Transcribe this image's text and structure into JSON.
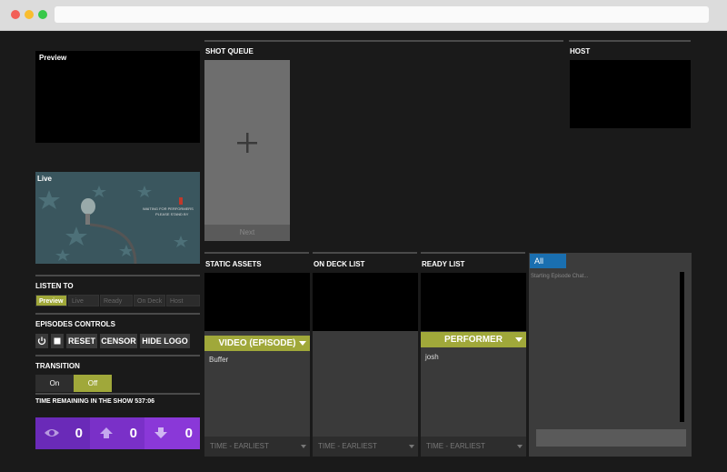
{
  "preview": {
    "label": "Preview"
  },
  "live": {
    "label": "Live",
    "poster_line1": "WAITING FOR PERFORMERS",
    "poster_line2": "PLEASE STAND BY"
  },
  "shot_queue": {
    "title": "SHOT QUEUE",
    "add_icon": "plus-icon",
    "next_label": "Next"
  },
  "host": {
    "title": "HOST"
  },
  "listen_to": {
    "title": "LISTEN TO",
    "options": [
      "Preview",
      "Live",
      "Ready",
      "On Deck",
      "Host"
    ],
    "selected": "Preview"
  },
  "episode_controls": {
    "title": "EPISODES CONTROLS",
    "power_icon": "power-icon",
    "stop_icon": "stop-icon",
    "reset_label": "RESET",
    "censor_label": "CENSOR",
    "hide_logo_label": "HIDE LOGO"
  },
  "transition": {
    "title": "TRANSITION",
    "on_label": "On",
    "off_label": "Off",
    "selected": "Off"
  },
  "time_remaining": {
    "label": "TIME REMAINING IN THE SHOW 537:06"
  },
  "counters": [
    {
      "icon": "eye-icon",
      "value": "0",
      "color": "#6a2ab8"
    },
    {
      "icon": "arrow-up-icon",
      "value": "0",
      "color": "#7a30c8"
    },
    {
      "icon": "arrow-down-icon",
      "value": "0",
      "color": "#8a38d8"
    }
  ],
  "static_assets": {
    "title": "STATIC ASSETS",
    "select_value": "VIDEO (EPISODE)",
    "items": [
      "Buffer"
    ],
    "sort_label": "TIME - EARLIEST"
  },
  "on_deck": {
    "title": "ON DECK LIST",
    "sort_label": "TIME - EARLIEST"
  },
  "ready_list": {
    "title": "READY LIST",
    "select_value": "PERFORMER",
    "items": [
      "josh"
    ],
    "sort_label": "TIME - EARLIEST"
  },
  "chat": {
    "tab_label": "All",
    "message": "Starting Episode Chat..."
  },
  "colors": {
    "accent_green": "#a0a83a",
    "chat_tab_blue": "#1a6fb0",
    "background": "#1a1a1a"
  }
}
